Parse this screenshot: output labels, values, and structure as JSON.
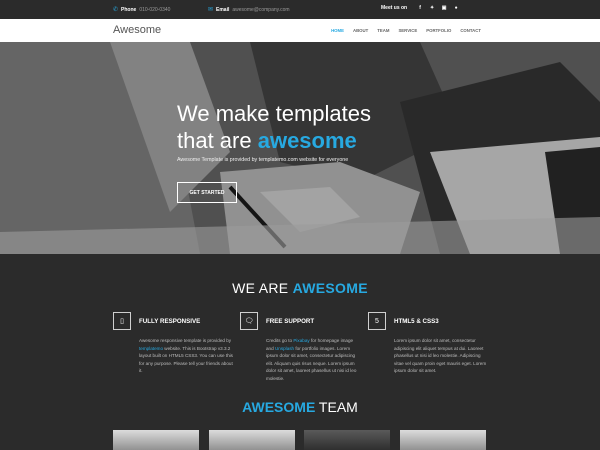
{
  "topbar": {
    "phone_label": "Phone",
    "phone_value": "010-020-0340",
    "email_label": "Email",
    "email_value": "awesome@company.com",
    "meet_label": "Meet us on",
    "social_icons": [
      "facebook-icon",
      "twitter-icon",
      "instagram-icon",
      "apple-icon"
    ]
  },
  "navbar": {
    "brand": "Awesome",
    "links": [
      "HOME",
      "ABOUT",
      "TEAM",
      "SERVICE",
      "PORTFOLIO",
      "CONTACT"
    ],
    "active": "HOME"
  },
  "hero": {
    "title_line1": "We make templates",
    "title_line2_prefix": "that are ",
    "title_highlight": "awesome",
    "subtitle": "Awesome Template is provided by templatemo.com website for everyone",
    "button": "GET STARTED"
  },
  "about": {
    "title_prefix": "WE ARE ",
    "title_highlight": "AWESOME",
    "features": [
      {
        "icon": "mobile-icon",
        "title": "FULLY RESPONSIVE",
        "text_before": "Awesome responsive template is provided by ",
        "link": "templatemo",
        "text_after": " website. This is Bootstrap v3.3.2 layout built on HTML5 CSS3. You can use this for any purpose. Please tell your friends about it."
      },
      {
        "icon": "chat-bubble-icon",
        "title": "FREE SUPPORT",
        "text_before": "Credits go to ",
        "link": "Pixabay",
        "text_mid": " for homepage image and ",
        "link2": "Unsplash",
        "text_after": " for portfolio images. Lorem ipsum dolor sit amet, consectetur adipiscing elit. Aliquam quis risus neque. Lorem ipsum dolor sit amet, laoreet phasellus ut nisi id leo molestie."
      },
      {
        "icon": "html5-icon",
        "title": "HTML5 & CSS3",
        "text": "Lorem ipsum dolor sit amet, consectetur adipiscing elit aliquet tempus at dui. Laoreet phasellus ut nisi id leo molestie. Adipiscing vitae vel quam proin eget mauris eget. Lorem ipsum dolor sit amet."
      }
    ]
  },
  "team": {
    "title_highlight": "AWESOME",
    "title_suffix": " TEAM"
  },
  "colors": {
    "accent": "#27a9e1",
    "dark_bg": "#2b2b2b"
  }
}
